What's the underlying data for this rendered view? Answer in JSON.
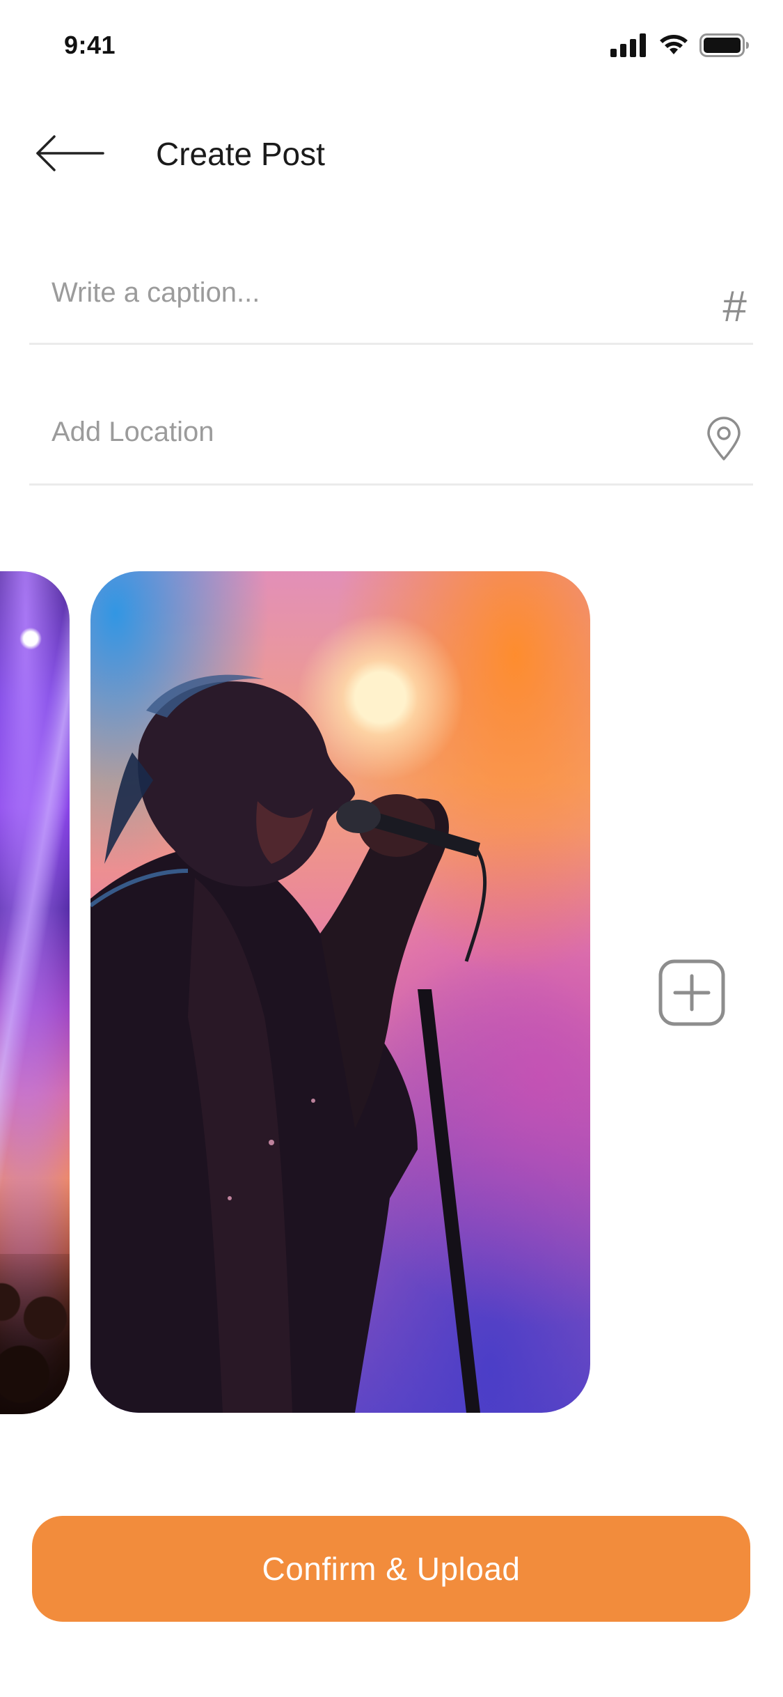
{
  "status_bar": {
    "time": "9:41",
    "icons": [
      "signal-icon",
      "wifi-icon",
      "battery-icon"
    ]
  },
  "header": {
    "back_icon": "arrow-left-icon",
    "title": "Create Post"
  },
  "caption": {
    "placeholder": "Write a caption...",
    "value": "",
    "icon": "hashtag-icon",
    "icon_glyph": "#"
  },
  "location": {
    "placeholder": "Add Location",
    "value": "",
    "icon": "location-pin-icon"
  },
  "gallery": {
    "photos": [
      {
        "name": "concert-crowd-photo"
      },
      {
        "name": "singer-photo"
      }
    ],
    "add_icon": "plus-square-icon"
  },
  "footer": {
    "confirm_label": "Confirm & Upload"
  },
  "colors": {
    "accent": "#f28c3c",
    "title_text": "#1a1a1a",
    "placeholder_text": "#9b9b9b",
    "icon_gray": "#8d8d8d",
    "divider": "#ebebeb"
  }
}
